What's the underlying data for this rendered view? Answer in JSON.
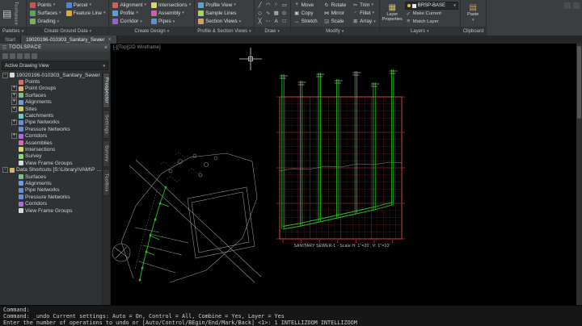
{
  "colors": {
    "bg": "#000000",
    "ribbon_bg": "#3b3e40",
    "ribbon_border": "#2a2c2d",
    "tree_bg": "#2f3234",
    "pipe_green": "#22c522",
    "grid_red_minor": "#4a1717",
    "grid_red_major": "#7a2424",
    "profile_border": "#c03c3c"
  },
  "ribbon": {
    "toolspace_vertical": "Toolspace",
    "palettes": {
      "label": "Palettes"
    },
    "ground": {
      "label": "Create Ground Data",
      "buttons": [
        {
          "label": "Points",
          "caret": "▾",
          "ic": "#d94f4f"
        },
        {
          "label": "Surfaces",
          "caret": "▾",
          "ic": "#58a858"
        },
        {
          "label": "Grading",
          "caret": "▾",
          "ic": "#7fae5a"
        },
        {
          "label": "Parcel",
          "caret": "▾",
          "ic": "#4f86d9"
        },
        {
          "label": "Feature Line",
          "caret": "▾",
          "ic": "#d9a84f"
        }
      ]
    },
    "design": {
      "label": "Create Design",
      "buttons": [
        {
          "label": "Alignment",
          "caret": "▾",
          "ic": "#d95a5a"
        },
        {
          "label": "Profile",
          "caret": "▾",
          "ic": "#5aa0d9"
        },
        {
          "label": "Corridor",
          "caret": "▾",
          "ic": "#a05ad9"
        },
        {
          "label": "Intersections",
          "caret": "▾",
          "ic": "#d9d95a"
        },
        {
          "label": "Assembly",
          "caret": "▾",
          "ic": "#d95aa0"
        },
        {
          "label": "Pipes",
          "caret": "▾",
          "ic": "#5a8fd9"
        }
      ]
    },
    "psv": {
      "label": "Profile & Section Views",
      "buttons": [
        {
          "label": "Profile View",
          "caret": "▾",
          "ic": "#5aa0d9"
        },
        {
          "label": "Sample Lines",
          "caret": "",
          "ic": "#a0d95a"
        },
        {
          "label": "Section Views",
          "caret": "▾",
          "ic": "#d9a05a"
        }
      ]
    },
    "draw": {
      "label": "Draw",
      "tools": [
        {
          "g": "╱"
        },
        {
          "g": "◠"
        },
        {
          "g": "○"
        },
        {
          "g": "▭"
        },
        {
          "g": "◇"
        },
        {
          "g": "∿"
        },
        {
          "g": "▦"
        },
        {
          "g": "⊙"
        },
        {
          "g": "╳"
        },
        {
          "g": "⋯"
        },
        {
          "g": "A"
        },
        {
          "g": "□"
        }
      ]
    },
    "modify": {
      "label": "Modify",
      "buttons": [
        {
          "g": "+",
          "label": "Move",
          "caret": ""
        },
        {
          "g": "▣",
          "label": "Copy",
          "caret": ""
        },
        {
          "g": "↔",
          "label": "Stretch",
          "caret": ""
        },
        {
          "g": "↻",
          "label": "Rotate",
          "caret": ""
        },
        {
          "g": "⋈",
          "label": "Mirror",
          "caret": ""
        },
        {
          "g": "◲",
          "label": "Scale",
          "caret": ""
        },
        {
          "g": "✂",
          "label": "Trim",
          "caret": "▾"
        },
        {
          "g": "◜",
          "label": "Fillet",
          "caret": "▾"
        },
        {
          "g": "⊞",
          "label": "Array",
          "caret": "▾"
        }
      ]
    },
    "layers": {
      "label": "Layers",
      "layer_properties": "Layer Properties",
      "current_layer": "BRSP-BASE",
      "make_current": "Make Current",
      "match_layer": "Match Layer"
    },
    "clipboard": {
      "label": "Clipboard",
      "paste": "Paste"
    }
  },
  "tabs": {
    "start": "Start",
    "drawing": "19020196-010303_Sanitary_Sewer"
  },
  "toolspace": {
    "title": "TOOLSPACE",
    "view_selector": "Active Drawing View",
    "side_tabs": [
      {
        "label": "Prospector",
        "active": true
      },
      {
        "label": "Settings"
      },
      {
        "label": "Survey"
      },
      {
        "label": "Toolbox"
      }
    ],
    "tree": [
      {
        "label": "19020196-010303_Sanitary_Sewer",
        "lvl": 0,
        "exp": "-",
        "ic": "#d9d9d9"
      },
      {
        "label": "Points",
        "lvl": 1,
        "exp": "",
        "ic": "#d96a6a"
      },
      {
        "label": "Point Groups",
        "lvl": 1,
        "exp": "+",
        "ic": "#d9b36a"
      },
      {
        "label": "Surfaces",
        "lvl": 1,
        "exp": "+",
        "ic": "#7fbf7f"
      },
      {
        "label": "Alignments",
        "lvl": 1,
        "exp": "+",
        "ic": "#6aa0d9"
      },
      {
        "label": "Sites",
        "lvl": 1,
        "exp": "+",
        "ic": "#c9c96a"
      },
      {
        "label": "Catchments",
        "lvl": 1,
        "exp": "",
        "ic": "#6ac9c9"
      },
      {
        "label": "Pipe Networks",
        "lvl": 1,
        "exp": "+",
        "ic": "#6a8fd9"
      },
      {
        "label": "Pressure Networks",
        "lvl": 1,
        "exp": "",
        "ic": "#6a8fd9"
      },
      {
        "label": "Corridors",
        "lvl": 1,
        "exp": "+",
        "ic": "#b06ad9"
      },
      {
        "label": "Assemblies",
        "lvl": 1,
        "exp": "",
        "ic": "#d96ab0"
      },
      {
        "label": "Intersections",
        "lvl": 1,
        "exp": "",
        "ic": "#d9d96a"
      },
      {
        "label": "Survey",
        "lvl": 1,
        "exp": "",
        "ic": "#8fd96a"
      },
      {
        "label": "View Frame Groups",
        "lvl": 1,
        "exp": "",
        "ic": "#d9d9d9"
      },
      {
        "label": "Data Shortcuts [S:\\Library\\VAM\\P Dove for Training]",
        "lvl": 0,
        "exp": "-",
        "ic": "#d9b36a"
      },
      {
        "label": "Surfaces",
        "lvl": 1,
        "exp": "",
        "ic": "#7fbf7f"
      },
      {
        "label": "Alignments",
        "lvl": 1,
        "exp": "",
        "ic": "#6aa0d9"
      },
      {
        "label": "Pipe Networks",
        "lvl": 1,
        "exp": "",
        "ic": "#6a8fd9"
      },
      {
        "label": "Pressure Networks",
        "lvl": 1,
        "exp": "",
        "ic": "#6a8fd9"
      },
      {
        "label": "Corridors",
        "lvl": 1,
        "exp": "",
        "ic": "#b06ad9"
      },
      {
        "label": "View Frame Groups",
        "lvl": 1,
        "exp": "",
        "ic": "#d9d9d9"
      }
    ]
  },
  "viewport": {
    "controls": "[-][Top][2D Wireframe]",
    "profile_caption": "SANITARY SEWER-1 - Scale H: 1\"=20', V: 1\"=10'"
  },
  "command": {
    "lines": [
      {
        "text": "Command:"
      },
      {
        "text": "Command:  _undo Current settings: Auto = On, Control = All, Combine = Yes, Layer = Yes"
      },
      {
        "text": "Enter the number of operations to undo or [Auto/Control/BEgin/End/Mark/Back] <1>: 1 INTELLIZOOM INTELLIZOOM"
      }
    ]
  }
}
